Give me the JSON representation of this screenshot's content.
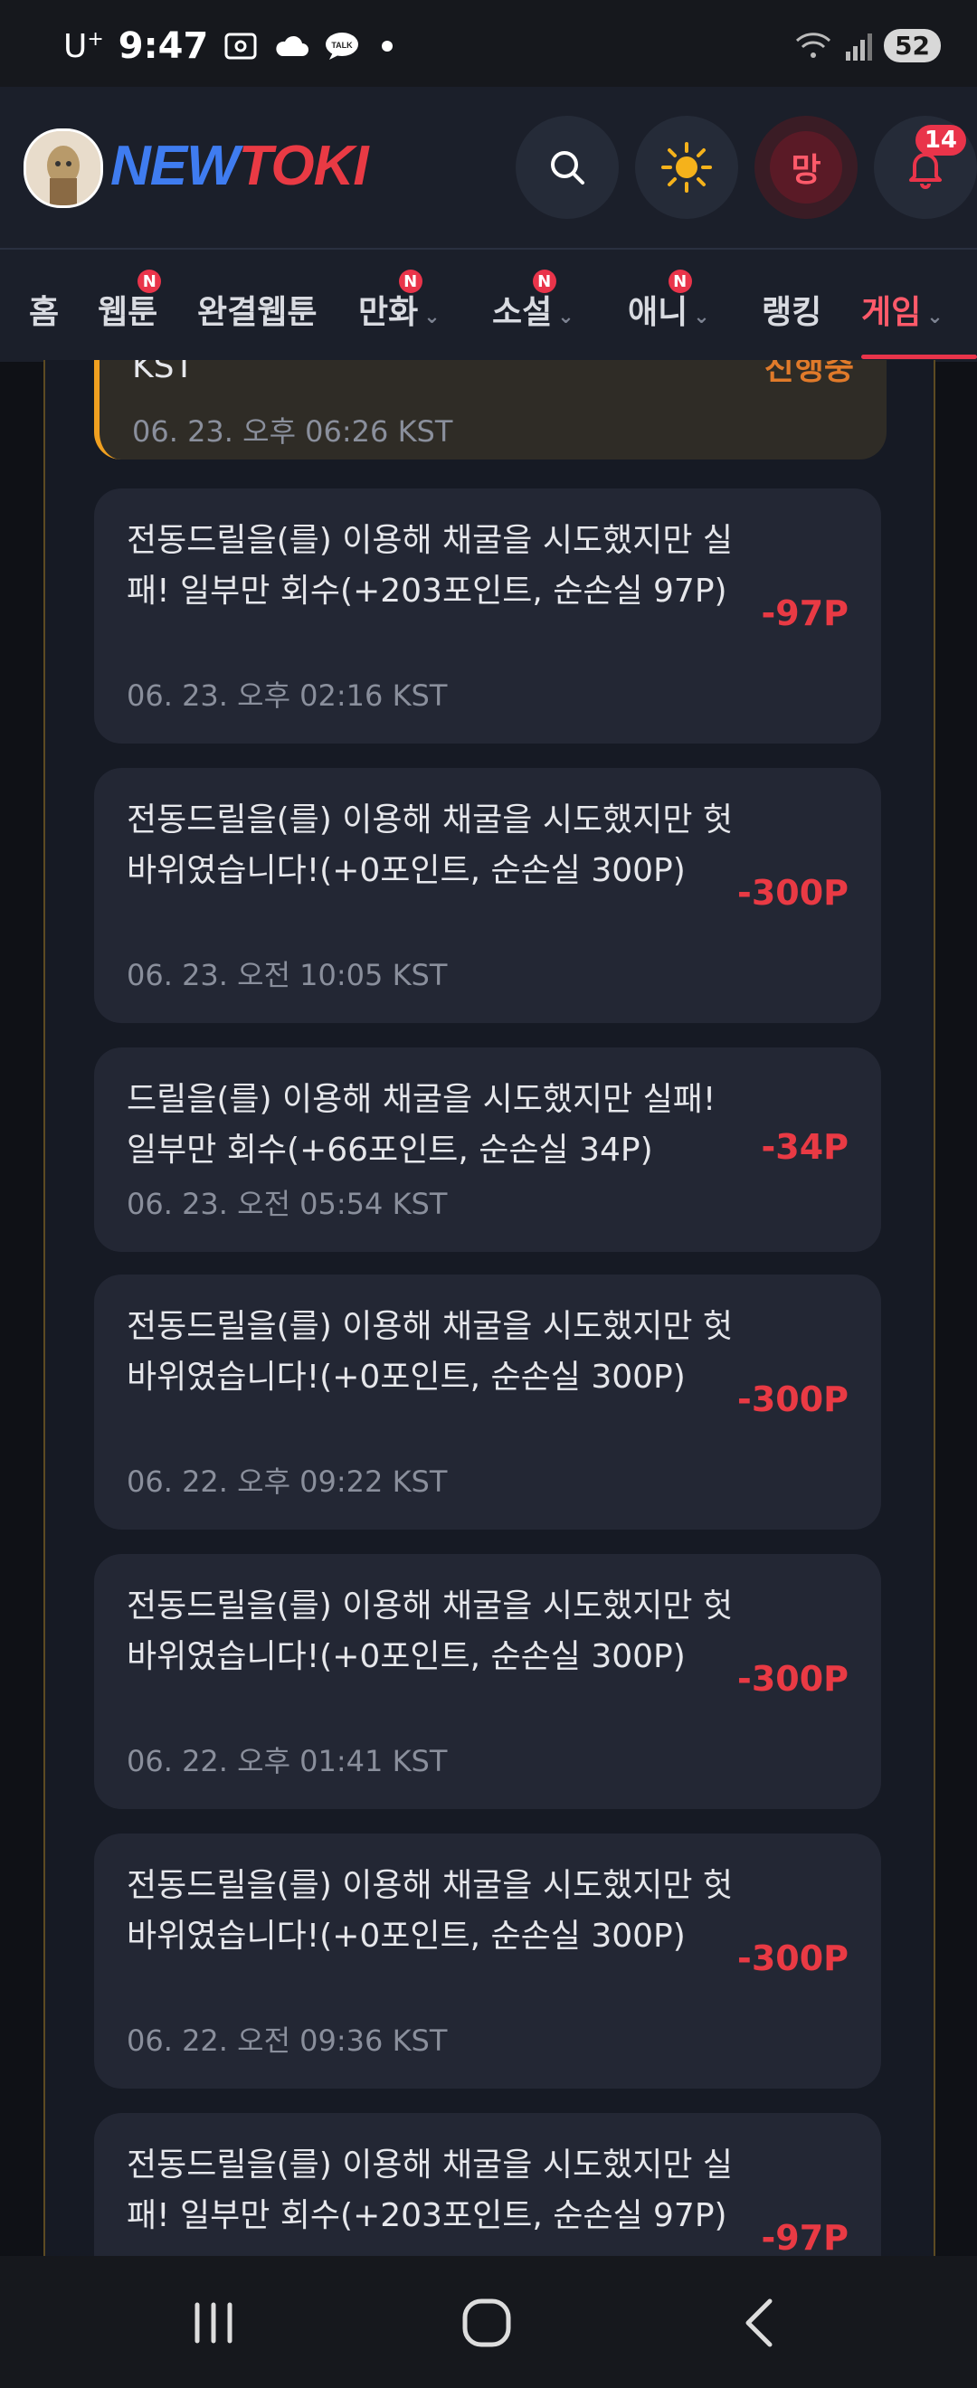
{
  "status_bar": {
    "carrier": "U",
    "carrier_sup": "+",
    "time": "9:47",
    "battery": "52",
    "icons": [
      "screenshot-icon",
      "cloud-icon",
      "talk-icon",
      "wifi-icon",
      "signal-icon"
    ]
  },
  "header": {
    "logo_part1": "NEW",
    "logo_part2": "TOKI",
    "user_button_label": "망",
    "notification_count": "14"
  },
  "nav": {
    "items": [
      {
        "label": "홈"
      },
      {
        "label": "웹툰",
        "badge": "N"
      },
      {
        "label": "완결웹툰"
      },
      {
        "label": "만화",
        "badge": "N"
      },
      {
        "label": "소설",
        "badge": "N"
      },
      {
        "label": "애니",
        "badge": "N"
      },
      {
        "label": "랭킹"
      },
      {
        "label": "게임"
      }
    ]
  },
  "history": [
    {
      "text": "KST",
      "date": "06. 23. 오후 06:26 KST",
      "status": "진행중"
    },
    {
      "text": "전동드릴을(를) 이용해 채굴을 시도했지만 실패! 일부만 회수(+203포인트, 순손실 97P)",
      "date": "06. 23. 오후 02:16 KST",
      "amount": "-97P"
    },
    {
      "text": "전동드릴을(를) 이용해 채굴을 시도했지만 헛바위였습니다!(+0포인트, 순손실 300P)",
      "date": "06. 23. 오전 10:05 KST",
      "amount": "-300P"
    },
    {
      "text": "드릴을(를) 이용해 채굴을 시도했지만 실패! 일부만 회수(+66포인트, 순손실 34P)",
      "date": "06. 23. 오전 05:54 KST",
      "amount": "-34P"
    },
    {
      "text": "전동드릴을(를) 이용해 채굴을 시도했지만 헛바위였습니다!(+0포인트, 순손실 300P)",
      "date": "06. 22. 오후 09:22 KST",
      "amount": "-300P"
    },
    {
      "text": "전동드릴을(를) 이용해 채굴을 시도했지만 헛바위였습니다!(+0포인트, 순손실 300P)",
      "date": "06. 22. 오후 01:41 KST",
      "amount": "-300P"
    },
    {
      "text": "전동드릴을(를) 이용해 채굴을 시도했지만 헛바위였습니다!(+0포인트, 순손실 300P)",
      "date": "06. 22. 오전 09:36 KST",
      "amount": "-300P"
    },
    {
      "text": "전동드릴을(를) 이용해 채굴을 시도했지만 실패! 일부만 회수(+203포인트, 순손실 97P)",
      "amount": "-97P"
    }
  ],
  "colors": {
    "background": "#0f1116",
    "card": "#232734",
    "accent_red": "#e93a44",
    "accent_orange": "#f0a020"
  },
  "bottom_nav": [
    "recents-icon",
    "home-icon",
    "back-icon"
  ]
}
